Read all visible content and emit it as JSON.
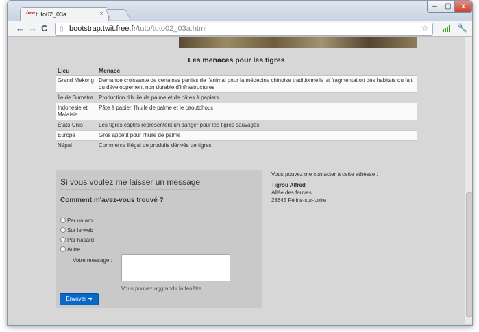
{
  "browser": {
    "tab_title": "tuto02_03a",
    "tab_favicon": "free",
    "tab_close": "×",
    "url_host": "bootstrap.twit.free.fr",
    "url_path": "/tuto/tuto02_03a.html",
    "nav_back": "←",
    "nav_forward": "→",
    "nav_reload": "C",
    "win_min": "–",
    "win_max": "▢",
    "win_close": "x"
  },
  "page": {
    "table": {
      "title": "Les menaces pour les tigres",
      "columns": [
        "Lieu",
        "Menace"
      ],
      "rows": [
        {
          "lieu": "Grand Mekong",
          "menace": "Demande croissante de certaines parties de l'animal pour la médecine chinoise traditionnelle et fragmentation des habitats du fait du développement non durable d'infrastructures"
        },
        {
          "lieu": "Île de Sumatra",
          "menace": "Production d'huile de palme et de pâtes à papiers"
        },
        {
          "lieu": "Indonésie et Malaisie",
          "menace": "Pâte à papier, l'huile de palme et le caoutchouc"
        },
        {
          "lieu": "États-Unis",
          "menace": "Les tigres captifs représentent un danger pour les tigres sauvages"
        },
        {
          "lieu": "Europe",
          "menace": "Gros appêtit pour l'huile de palme"
        },
        {
          "lieu": "Népal",
          "menace": "Commerce illégal de produits dérivés de tigres"
        }
      ]
    },
    "form": {
      "title": "Si vous voulez me laisser un message",
      "question": "Comment m'avez-vous trouvé ?",
      "options": [
        "Par un ami",
        "Sur le web",
        "Par hasard",
        "Autre..."
      ],
      "message_label": "Votre message :",
      "hint": "Vous pouvez aggrandir la fenêtre",
      "submit": "Envoyer"
    },
    "contact": {
      "intro": "Vous pouvez me contacter à cette adresse :",
      "name": "Tigrou Alfred",
      "street": "Allée des fauves",
      "city": "28645 Félins-sur-Loire"
    }
  }
}
